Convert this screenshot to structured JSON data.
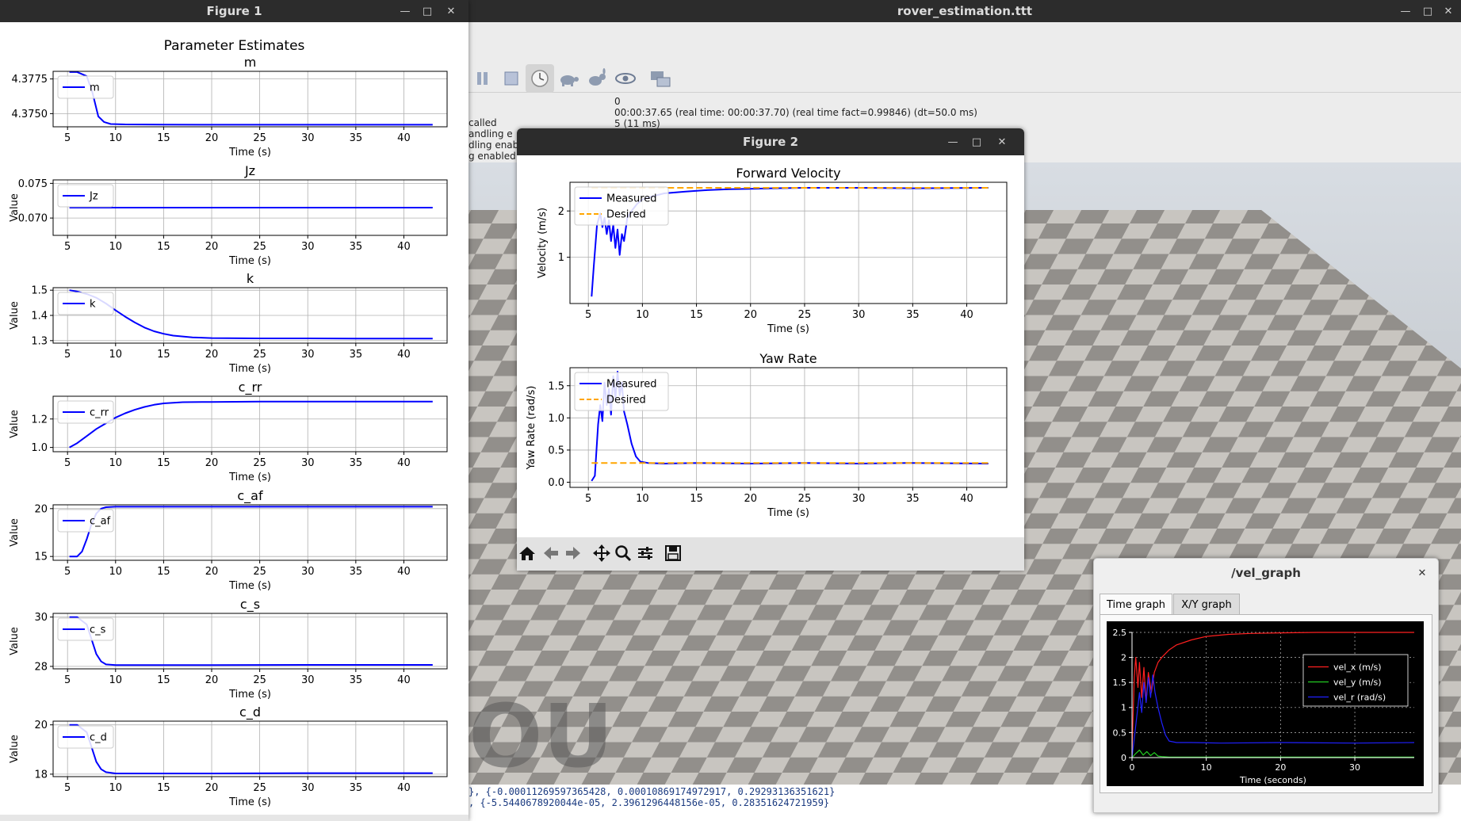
{
  "main_window": {
    "title": "rover_estimation.ttt",
    "status_lines": [
      "0",
      "00:00:37.65 (real time: 00:00:37.70) (real time fact=0.99846) (dt=50.0 ms)",
      "5 (11 ms)"
    ],
    "left_console": [
      "called",
      "andling e",
      "dling enab",
      "g enabled"
    ],
    "bottom_console": [
      "}, {-0.00011269597365428, 0.00010869174972917, 0.29293136351621}",
      ", {-5.5440678920044e-05, 2.3961296448156e-05, 0.28351624721959}"
    ],
    "watermark": "OU",
    "toolbar_icons": [
      "pause-icon",
      "stop-icon",
      "clock-icon",
      "turtle-icon",
      "rabbit-icon",
      "eye-icon",
      "network-icon"
    ]
  },
  "figure1": {
    "title": "Figure 1",
    "suptitle": "Parameter Estimates"
  },
  "figure2": {
    "title": "Figure 2",
    "toolbar_icons": [
      "home-icon",
      "back-icon",
      "forward-icon",
      "pan-icon",
      "zoom-icon",
      "configure-icon",
      "save-icon"
    ]
  },
  "vel_graph": {
    "title": "/vel_graph",
    "tabs": [
      "Time graph",
      "X/Y graph"
    ],
    "active_tab": 0
  },
  "chart_data": [
    {
      "id": "fig1_m",
      "type": "line",
      "title": "m",
      "xlabel": "Time (s)",
      "ylabel": "",
      "xlim": [
        3.5,
        44.5
      ],
      "ylim": [
        4.37405,
        4.37805
      ],
      "xticks": [
        5,
        10,
        15,
        20,
        25,
        30,
        35,
        40
      ],
      "yticks": [
        4.375,
        4.3775
      ],
      "ytick_labels": [
        "4.3750",
        "4.3775"
      ],
      "grid": true,
      "legend": "upper-left",
      "series": [
        {
          "name": "m",
          "color": "#0000ff",
          "x": [
            5.2,
            6,
            7,
            7.6,
            8.2,
            8.8,
            9.5,
            11,
            15,
            20,
            30,
            43
          ],
          "y": [
            4.378,
            4.378,
            4.3777,
            4.3765,
            4.3748,
            4.3744,
            4.37425,
            4.37422,
            4.37421,
            4.3742,
            4.3742,
            4.3742
          ]
        }
      ]
    },
    {
      "id": "fig1_Jz",
      "type": "line",
      "title": "Jz",
      "xlabel": "Time (s)",
      "ylabel": "Value",
      "xlim": [
        3.5,
        44.5
      ],
      "ylim": [
        0.0675,
        0.0755
      ],
      "xticks": [
        5,
        10,
        15,
        20,
        25,
        30,
        35,
        40
      ],
      "yticks": [
        0.07,
        0.075
      ],
      "ytick_labels": [
        "0.070",
        "0.075"
      ],
      "grid": true,
      "legend": "upper-left",
      "series": [
        {
          "name": "Jz",
          "color": "#0000ff",
          "x": [
            5.2,
            43
          ],
          "y": [
            0.0715,
            0.0715
          ]
        }
      ]
    },
    {
      "id": "fig1_k",
      "type": "line",
      "title": "k",
      "xlabel": "Time (s)",
      "ylabel": "Value",
      "xlim": [
        3.5,
        44.5
      ],
      "ylim": [
        1.29,
        1.51
      ],
      "xticks": [
        5,
        10,
        15,
        20,
        25,
        30,
        35,
        40
      ],
      "yticks": [
        1.3,
        1.4,
        1.5
      ],
      "ytick_labels": [
        "1.3",
        "1.4",
        "1.5"
      ],
      "grid": true,
      "legend": "upper-left",
      "series": [
        {
          "name": "k",
          "color": "#0000ff",
          "x": [
            5.2,
            6,
            7,
            8,
            9,
            10,
            11,
            12,
            13,
            14,
            15,
            16,
            18,
            20,
            25,
            30,
            35,
            43
          ],
          "y": [
            1.5,
            1.495,
            1.485,
            1.47,
            1.447,
            1.42,
            1.395,
            1.372,
            1.352,
            1.337,
            1.327,
            1.32,
            1.313,
            1.31,
            1.309,
            1.309,
            1.308,
            1.308
          ]
        }
      ]
    },
    {
      "id": "fig1_c_rr",
      "type": "line",
      "title": "c_rr",
      "xlabel": "Time (s)",
      "ylabel": "Value",
      "xlim": [
        3.5,
        44.5
      ],
      "ylim": [
        0.97,
        1.36
      ],
      "xticks": [
        5,
        10,
        15,
        20,
        25,
        30,
        35,
        40
      ],
      "yticks": [
        1.0,
        1.2
      ],
      "ytick_labels": [
        "1.0",
        "1.2"
      ],
      "grid": true,
      "legend": "upper-left",
      "series": [
        {
          "name": "c_rr",
          "color": "#0000ff",
          "x": [
            5.2,
            6,
            7,
            8,
            9,
            10,
            11,
            12,
            13,
            14,
            15,
            17,
            20,
            25,
            30,
            35,
            43
          ],
          "y": [
            1.0,
            1.03,
            1.08,
            1.13,
            1.17,
            1.21,
            1.24,
            1.265,
            1.285,
            1.3,
            1.31,
            1.318,
            1.32,
            1.322,
            1.322,
            1.322,
            1.322
          ]
        }
      ]
    },
    {
      "id": "fig1_c_af",
      "type": "line",
      "title": "c_af",
      "xlabel": "Time (s)",
      "ylabel": "Value",
      "xlim": [
        3.5,
        44.5
      ],
      "ylim": [
        14.6,
        20.4
      ],
      "xticks": [
        5,
        10,
        15,
        20,
        25,
        30,
        35,
        40
      ],
      "yticks": [
        15,
        20
      ],
      "ytick_labels": [
        "15",
        "20"
      ],
      "grid": true,
      "legend": "upper-left",
      "series": [
        {
          "name": "c_af",
          "color": "#0000ff",
          "x": [
            5.2,
            6,
            6.5,
            7,
            7.5,
            8,
            8.5,
            9,
            10,
            12,
            15,
            20,
            30,
            43
          ],
          "y": [
            15,
            15,
            15.5,
            16.8,
            18.4,
            19.5,
            20.0,
            20.15,
            20.2,
            20.2,
            20.2,
            20.2,
            20.2,
            20.2
          ]
        }
      ]
    },
    {
      "id": "fig1_c_s",
      "type": "line",
      "title": "c_s",
      "xlabel": "Time (s)",
      "ylabel": "Value",
      "xlim": [
        3.5,
        44.5
      ],
      "ylim": [
        27.9,
        30.15
      ],
      "xticks": [
        5,
        10,
        15,
        20,
        25,
        30,
        35,
        40
      ],
      "yticks": [
        28,
        30
      ],
      "ytick_labels": [
        "28",
        "30"
      ],
      "grid": true,
      "legend": "upper-left",
      "series": [
        {
          "name": "c_s",
          "color": "#0000ff",
          "x": [
            5.2,
            6,
            7,
            7.5,
            8,
            8.5,
            9,
            10,
            12,
            15,
            20,
            30,
            43
          ],
          "y": [
            30,
            30,
            29.7,
            29.1,
            28.5,
            28.2,
            28.08,
            28.05,
            28.05,
            28.05,
            28.05,
            28.06,
            28.06
          ]
        }
      ]
    },
    {
      "id": "fig1_c_d",
      "type": "line",
      "title": "c_d",
      "xlabel": "Time (s)",
      "ylabel": "Value",
      "xlim": [
        3.5,
        44.5
      ],
      "ylim": [
        17.9,
        20.15
      ],
      "xticks": [
        5,
        10,
        15,
        20,
        25,
        30,
        35,
        40
      ],
      "yticks": [
        18,
        20
      ],
      "ytick_labels": [
        "18",
        "20"
      ],
      "grid": true,
      "legend": "upper-left",
      "series": [
        {
          "name": "c_d",
          "color": "#0000ff",
          "x": [
            5.2,
            6,
            7,
            7.5,
            8,
            8.5,
            9,
            10,
            12,
            15,
            20,
            30,
            43
          ],
          "y": [
            20,
            20,
            19.7,
            19.1,
            18.5,
            18.2,
            18.08,
            18.03,
            18.03,
            18.03,
            18.03,
            18.04,
            18.04
          ]
        }
      ]
    },
    {
      "id": "fig2_forward_velocity",
      "type": "line",
      "title": "Forward Velocity",
      "xlabel": "Time (s)",
      "ylabel": "Velocity (m/s)",
      "xlim": [
        3.3,
        43.7
      ],
      "ylim": [
        0.0,
        2.62
      ],
      "xticks": [
        5,
        10,
        15,
        20,
        25,
        30,
        35,
        40
      ],
      "yticks": [
        1,
        2
      ],
      "ytick_labels": [
        "1",
        "2"
      ],
      "grid": true,
      "legend": "upper-left",
      "series": [
        {
          "name": "Measured",
          "color": "#0000ff",
          "style": "solid",
          "x": [
            5.3,
            5.5,
            5.8,
            6.1,
            6.3,
            6.5,
            6.7,
            6.9,
            7.1,
            7.3,
            7.5,
            7.7,
            7.9,
            8.1,
            8.3,
            8.6,
            9,
            9.5,
            10,
            11,
            12,
            14,
            16,
            18,
            20,
            22,
            25,
            30,
            35,
            42
          ],
          "y": [
            0.15,
            0.8,
            1.7,
            1.95,
            1.65,
            1.85,
            1.5,
            1.8,
            1.35,
            1.7,
            1.2,
            1.6,
            1.05,
            1.5,
            1.35,
            1.85,
            2.0,
            2.15,
            2.25,
            2.32,
            2.38,
            2.42,
            2.45,
            2.47,
            2.48,
            2.49,
            2.5,
            2.5,
            2.49,
            2.5
          ]
        },
        {
          "name": "Desired",
          "color": "#ffa500",
          "style": "dashed",
          "x": [
            5.3,
            42
          ],
          "y": [
            2.5,
            2.5
          ]
        }
      ]
    },
    {
      "id": "fig2_yaw_rate",
      "type": "line",
      "title": "Yaw Rate",
      "xlabel": "Time (s)",
      "ylabel": "Yaw Rate (rad/s)",
      "xlim": [
        3.3,
        43.7
      ],
      "ylim": [
        -0.08,
        1.78
      ],
      "xticks": [
        5,
        10,
        15,
        20,
        25,
        30,
        35,
        40
      ],
      "yticks": [
        0.0,
        0.5,
        1.0,
        1.5
      ],
      "ytick_labels": [
        "0.0",
        "0.5",
        "1.0",
        "1.5"
      ],
      "grid": true,
      "legend": "upper-left",
      "series": [
        {
          "name": "Measured",
          "color": "#0000ff",
          "style": "solid",
          "x": [
            5.3,
            5.6,
            5.9,
            6.1,
            6.3,
            6.5,
            6.7,
            6.9,
            7.1,
            7.3,
            7.5,
            7.7,
            7.9,
            8.1,
            8.3,
            8.6,
            9,
            9.4,
            9.8,
            10.5,
            12,
            15,
            20,
            25,
            30,
            35,
            42
          ],
          "y": [
            0.02,
            0.1,
            0.9,
            1.2,
            0.95,
            1.55,
            1.2,
            1.45,
            1.05,
            1.65,
            1.3,
            1.72,
            1.35,
            1.55,
            1.1,
            0.9,
            0.6,
            0.4,
            0.32,
            0.3,
            0.29,
            0.3,
            0.29,
            0.3,
            0.29,
            0.3,
            0.29
          ]
        },
        {
          "name": "Desired",
          "color": "#ffa500",
          "style": "dashed",
          "x": [
            5.3,
            42
          ],
          "y": [
            0.3,
            0.3
          ]
        }
      ]
    },
    {
      "id": "vel_graph_time",
      "type": "line",
      "title": "",
      "xlabel": "Time (seconds)",
      "ylabel": "",
      "xlim": [
        0,
        38
      ],
      "ylim": [
        0,
        2.5
      ],
      "xticks": [
        0,
        10,
        20,
        30
      ],
      "yticks": [
        0,
        0.5,
        1,
        1.5,
        2,
        2.5
      ],
      "ytick_labels": [
        "0",
        "0.5",
        "1",
        "1.5",
        "2",
        "2.5"
      ],
      "grid": true,
      "legend": "upper-right",
      "series": [
        {
          "name": "vel_x (m/s)",
          "color": "#ff2020",
          "x": [
            0,
            0.3,
            0.5,
            0.8,
            1.0,
            1.3,
            1.6,
            1.9,
            2.2,
            2.6,
            3,
            3.5,
            4,
            5,
            6,
            8,
            10,
            13,
            16,
            20,
            25,
            30,
            38
          ],
          "y": [
            0.1,
            1.6,
            2.0,
            1.4,
            1.9,
            1.2,
            1.8,
            1.1,
            1.7,
            1.3,
            1.7,
            1.9,
            2.0,
            2.15,
            2.25,
            2.35,
            2.42,
            2.46,
            2.48,
            2.49,
            2.5,
            2.5,
            2.5
          ]
        },
        {
          "name": "vel_y (m/s)",
          "color": "#22cc22",
          "x": [
            0,
            0.5,
            1,
            1.5,
            2,
            2.5,
            3,
            3.5,
            4,
            5,
            6,
            10,
            20,
            38
          ],
          "y": [
            0,
            0.08,
            0.15,
            0.05,
            0.12,
            0.04,
            0.1,
            0.03,
            0.02,
            0.01,
            0.01,
            0.01,
            0.01,
            0.01
          ]
        },
        {
          "name": "vel_r (rad/s)",
          "color": "#2020ff",
          "x": [
            0,
            0.4,
            0.7,
            1,
            1.3,
            1.6,
            1.9,
            2.2,
            2.5,
            2.8,
            3.1,
            3.5,
            4,
            4.5,
            5,
            6,
            8,
            12,
            20,
            30,
            38
          ],
          "y": [
            0,
            0.5,
            0.9,
            1.3,
            0.9,
            1.5,
            1.1,
            1.6,
            1.2,
            1.65,
            1.3,
            1.0,
            0.7,
            0.45,
            0.33,
            0.3,
            0.3,
            0.29,
            0.3,
            0.29,
            0.3
          ]
        }
      ]
    }
  ]
}
